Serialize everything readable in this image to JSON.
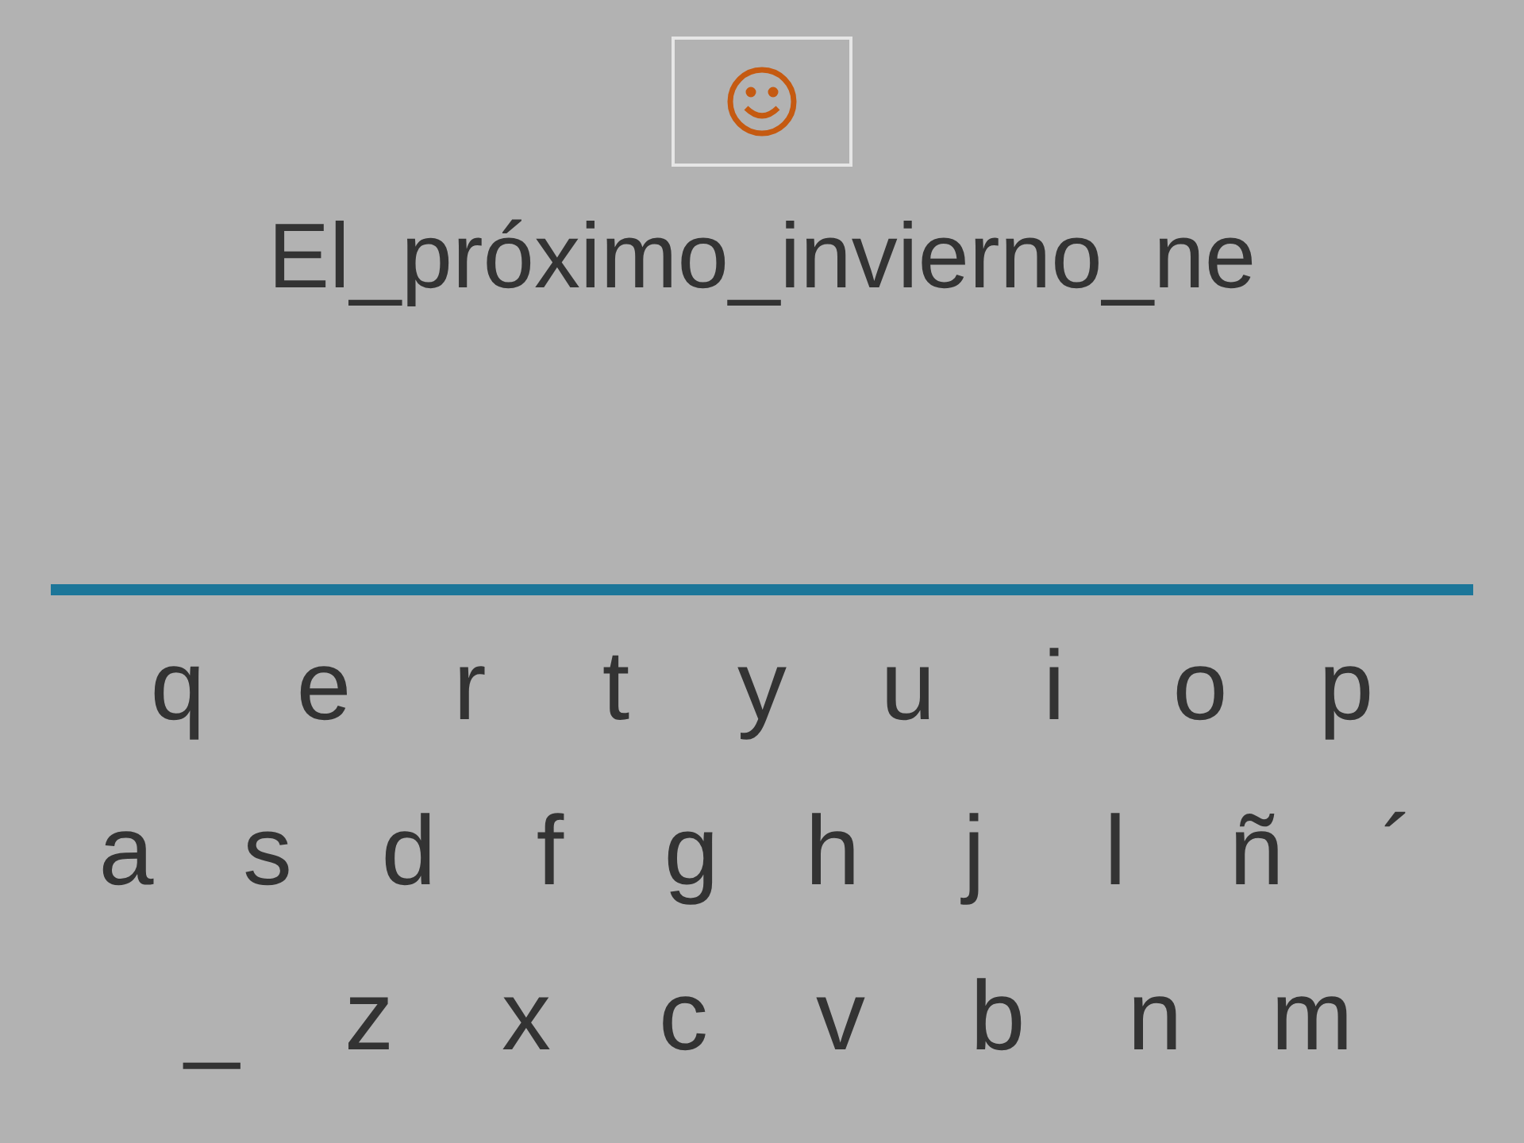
{
  "phrase": "El_próximo_invierno_ne",
  "keyboard": [
    [
      "q",
      "e",
      "r",
      "t",
      "y",
      "u",
      "i",
      "o",
      "p"
    ],
    [
      "a",
      "s",
      "d",
      "f",
      "g",
      "h",
      "j",
      "l",
      "ñ",
      "´"
    ],
    [
      "_",
      "z",
      "x",
      "c",
      "v",
      "b",
      "n",
      "m"
    ]
  ]
}
